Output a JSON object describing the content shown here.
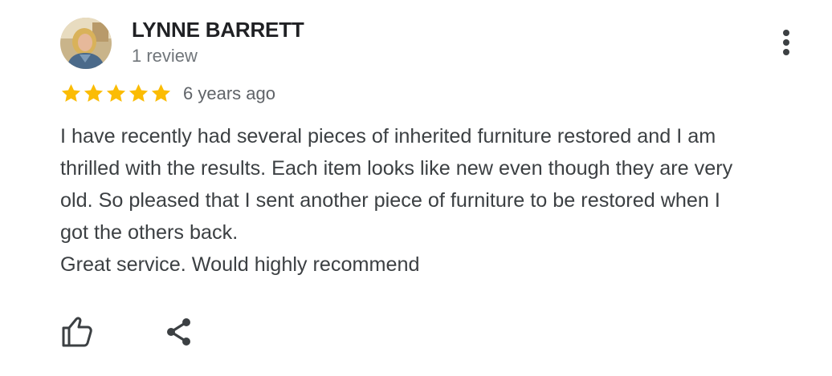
{
  "review": {
    "author_name": "LYNNE BARRETT",
    "review_count": "1 review",
    "rating": 5,
    "max_rating": 5,
    "time_ago": "6 years ago",
    "text_lines": [
      "I have recently had several pieces of inherited furniture restored and I am",
      "thrilled with the results. Each item looks like new even though they are very",
      "old. So pleased that I sent another piece of furniture to be restored when I",
      "got the others back.",
      "Great service. Would highly recommend"
    ]
  },
  "icons": {
    "avatar": "avatar-photo",
    "more": "more-vert-icon",
    "star": "star-icon",
    "like": "thumb-up-icon",
    "share": "share-icon"
  },
  "colors": {
    "star": "#fbbc04",
    "name": "#202124",
    "secondary_text": "#70757a",
    "body_text": "#3c4043",
    "icon": "#3c4043"
  }
}
